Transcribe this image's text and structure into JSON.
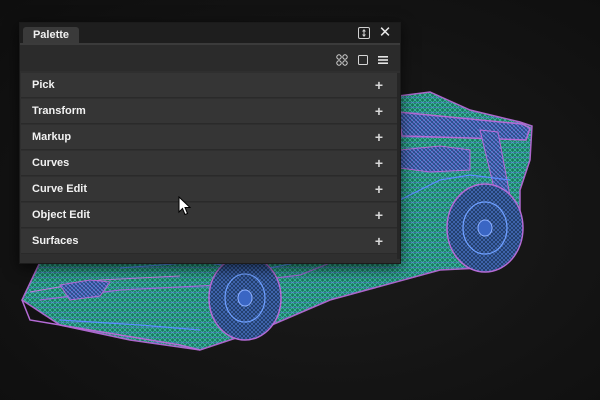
{
  "palette": {
    "tab_title": "Palette",
    "title_icons": {
      "collapse": "collapse-icon",
      "close": "close-icon",
      "close_glyph": "✕"
    },
    "toolbar_icons": [
      "grid-view-icon",
      "single-view-icon",
      "menu-icon"
    ],
    "items": [
      {
        "label": "Pick",
        "expand": "+"
      },
      {
        "label": "Transform",
        "expand": "+"
      },
      {
        "label": "Markup",
        "expand": "+"
      },
      {
        "label": "Curves",
        "expand": "+"
      },
      {
        "label": "Curve Edit",
        "expand": "+"
      },
      {
        "label": "Object Edit",
        "expand": "+"
      },
      {
        "label": "Surfaces",
        "expand": "+"
      }
    ]
  },
  "viewport": {
    "background": "#141414",
    "wireframe_colors": [
      "#2ec9a0",
      "#5b8cff",
      "#b56bd6"
    ]
  }
}
